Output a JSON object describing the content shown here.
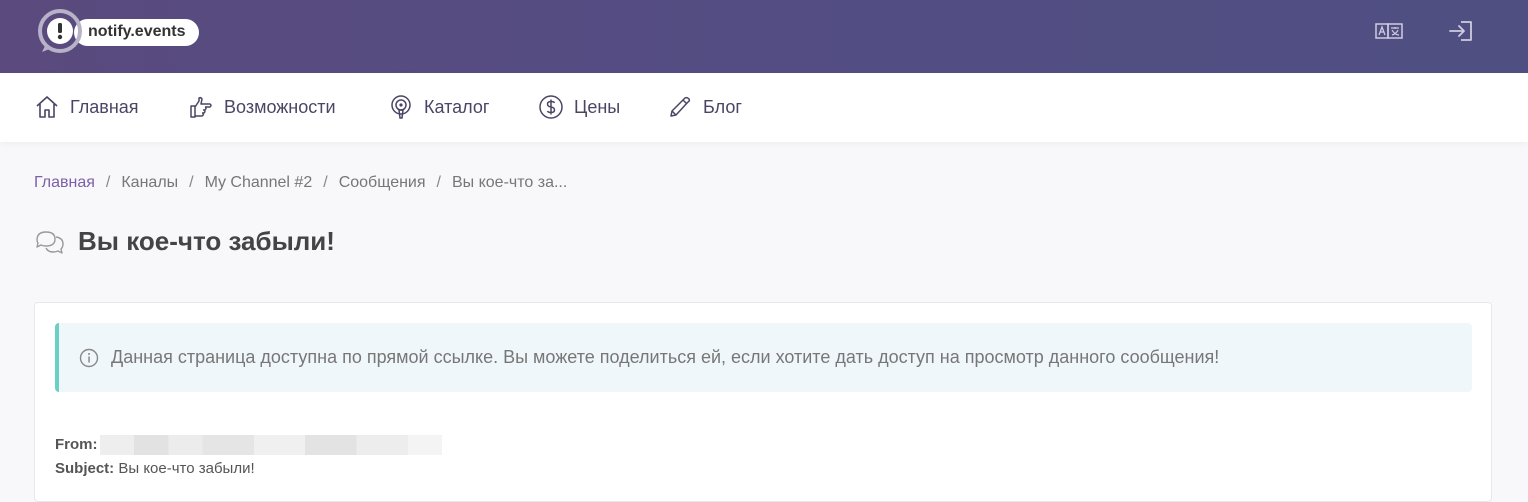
{
  "header": {
    "logo_text": "notify.events",
    "logo_icon": "exclamation-bubble-icon",
    "language_icon": "translate-icon",
    "login_icon": "login-icon"
  },
  "nav": {
    "items": [
      {
        "label": "Главная",
        "icon": "home-icon"
      },
      {
        "label": "Возможности",
        "icon": "pointing-hand-icon"
      },
      {
        "label": "Каталог",
        "icon": "podcast-icon"
      },
      {
        "label": "Цены",
        "icon": "dollar-icon"
      },
      {
        "label": "Блог",
        "icon": "pen-icon"
      }
    ]
  },
  "breadcrumb": {
    "items": [
      "Главная",
      "Каналы",
      "My Channel #2",
      "Сообщения",
      "Вы кое-что за..."
    ],
    "separator": "/"
  },
  "page": {
    "title": "Вы кое-что забыли!",
    "title_icon": "chat-bubbles-icon"
  },
  "alert": {
    "text": "Данная страница доступна по прямой ссылке. Вы можете поделиться ей, если хотите дать доступ на просмотр данного сообщения!",
    "icon": "info-icon"
  },
  "message": {
    "from_label": "From:",
    "subject_label": "Subject:",
    "subject_value": "Вы кое-что забыли!"
  },
  "colors": {
    "header_gradient_start": "#5a4a7e",
    "header_gradient_end": "#4f4f82",
    "alert_border": "#6ad0c4",
    "breadcrumb_link": "#7c5fa8"
  }
}
